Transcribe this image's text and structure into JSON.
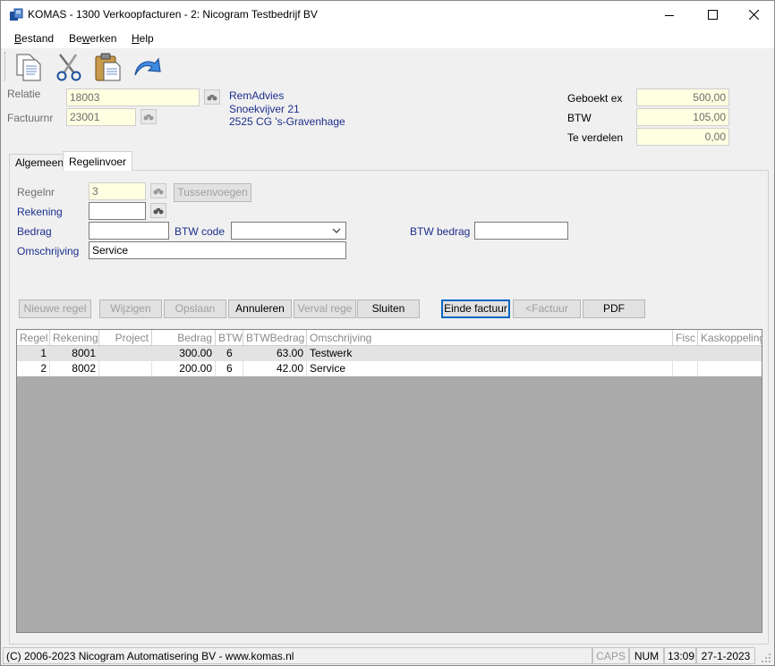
{
  "window": {
    "title": "KOMAS - 1300 Verkoopfacturen - 2: Nicogram Testbedrijf BV"
  },
  "menu": [
    {
      "label_u": "B",
      "label_rest": "estand"
    },
    {
      "label_pre": "Be",
      "label_u": "w",
      "label_rest": "erken"
    },
    {
      "label_u": "H",
      "label_rest": "elp"
    }
  ],
  "toolbar": {
    "icons": [
      "copy-icon",
      "cut-icon",
      "paste-icon",
      "undo-icon"
    ]
  },
  "header": {
    "relatie_label": "Relatie",
    "relatie_value": "18003",
    "factuurnr_label": "Factuurnr",
    "factuurnr_value": "23001",
    "address": [
      "RemAdvies",
      "Snoekvijver 21",
      "2525 CG 's-Gravenhage"
    ],
    "geboekt_ex_label": "Geboekt ex",
    "geboekt_ex_value": "500,00",
    "btw_label": "BTW",
    "btw_value": "105,00",
    "te_verdelen_label": "Te verdelen",
    "te_verdelen_value": "0,00"
  },
  "tabs": [
    {
      "label": "Algemeen",
      "active": false
    },
    {
      "label": "Regelinvoer",
      "active": true
    }
  ],
  "form": {
    "regelnr_label": "Regelnr",
    "regelnr_value": "3",
    "tussenvoegen_label": "Tussenvoegen",
    "rekening_label": "Rekening",
    "rekening_value": "",
    "bedrag_label": "Bedrag",
    "bedrag_value": "",
    "btw_code_label": "BTW code",
    "btw_code_value": "",
    "btw_bedrag_label": "BTW bedrag",
    "btw_bedrag_value": "",
    "omschrijving_label": "Omschrijving",
    "omschrijving_value": "Service"
  },
  "actions": {
    "nieuwe_regel": "Nieuwe regel",
    "wijzigen": "Wijzigen",
    "opslaan": "Opslaan",
    "annuleren": "Annuleren",
    "verval_regel": "Verval rege",
    "sluiten": "Sluiten",
    "einde_factuur": "Einde factuur",
    "factuur_prev": "<Factuur",
    "pdf": "PDF"
  },
  "grid": {
    "headers": [
      "Regel",
      "Rekening",
      "Project",
      "Bedrag",
      "BTW",
      "BTWBedrag",
      "Omschrijving",
      "Fisc",
      "Kaskoppeling"
    ],
    "rows": [
      [
        "1",
        "8001",
        "",
        "300.00",
        "6",
        "63.00",
        "Testwerk",
        "",
        ""
      ],
      [
        "2",
        "8002",
        "",
        "200.00",
        "6",
        "42.00",
        "Service",
        "",
        ""
      ]
    ]
  },
  "status": {
    "copyright": "(C) 2006-2023 Nicogram Automatisering BV - www.komas.nl",
    "caps": "CAPS",
    "num": "NUM",
    "time": "13:09",
    "date": "27-1-2023"
  },
  "colors": {
    "label_blue": "#1c2e8c",
    "readonly_yellow": "#ffffe1",
    "grid_background": "#ababab",
    "focus_blue": "#0b66c2"
  }
}
